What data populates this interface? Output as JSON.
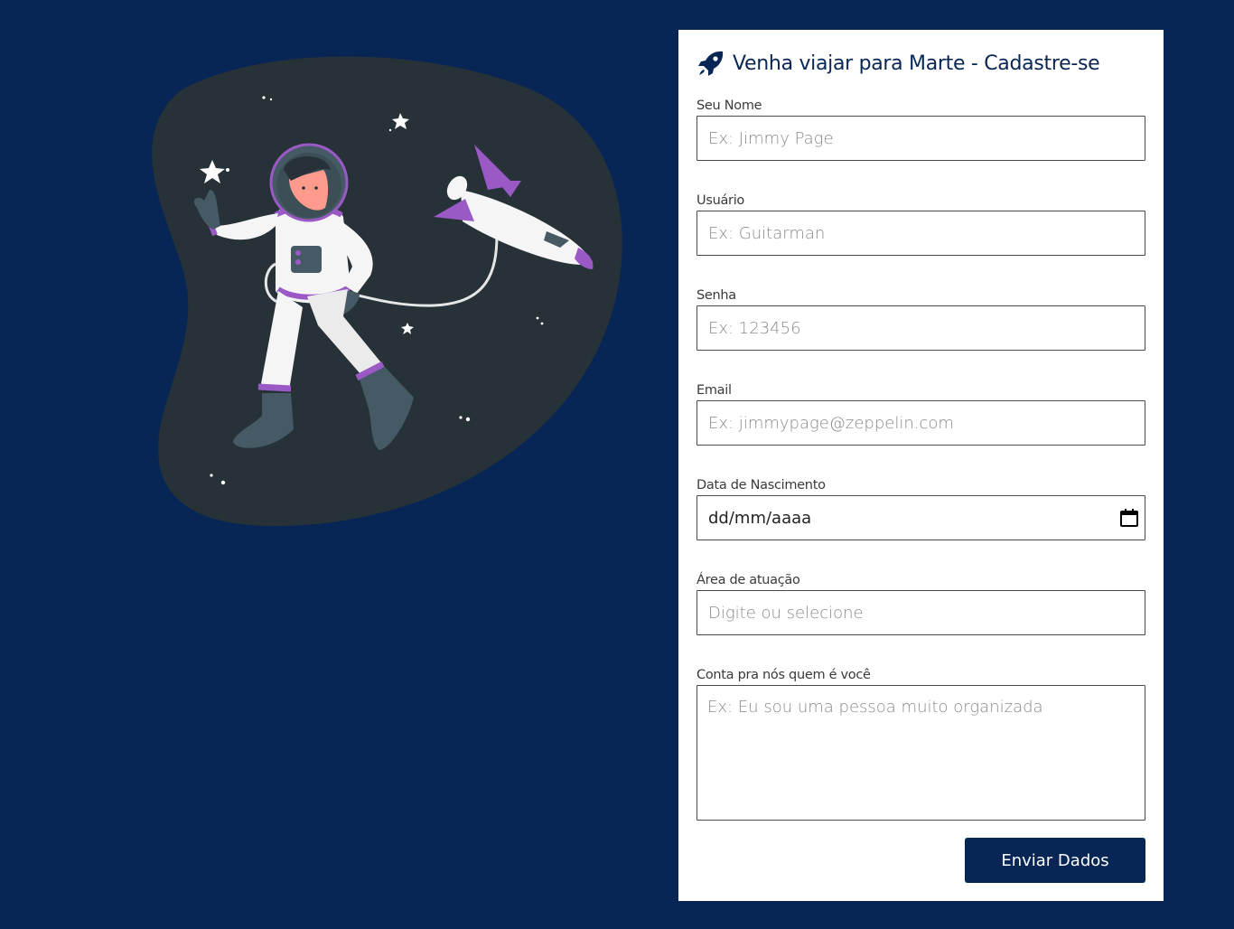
{
  "form": {
    "title": "Venha viajar para Marte - Cadastre-se",
    "fields": [
      {
        "label": "Seu Nome",
        "placeholder": "Ex: Jimmy Page"
      },
      {
        "label": "Usuário",
        "placeholder": "Ex: Guitarman"
      },
      {
        "label": "Senha",
        "placeholder": "Ex: 123456"
      },
      {
        "label": "Email",
        "placeholder": "Ex: jimmypage@zeppelin.com"
      },
      {
        "label": "Data de Nascimento",
        "placeholder": "dd/mm/aaaa"
      },
      {
        "label": "Área de atuação",
        "placeholder": "Digite ou selecione"
      },
      {
        "label": "Conta pra nós quem é você",
        "placeholder": "Ex: Eu sou uma pessoa muito organizada"
      }
    ],
    "submit_label": "Enviar Dados"
  },
  "colors": {
    "background": "#082655",
    "accent": "#082655",
    "illustration_blob": "#263238",
    "suit_accent": "#9b59c6"
  },
  "icons": {
    "title_icon": "rocket-icon",
    "date_icon": "calendar-icon",
    "illustration": "astronaut-illustration"
  }
}
